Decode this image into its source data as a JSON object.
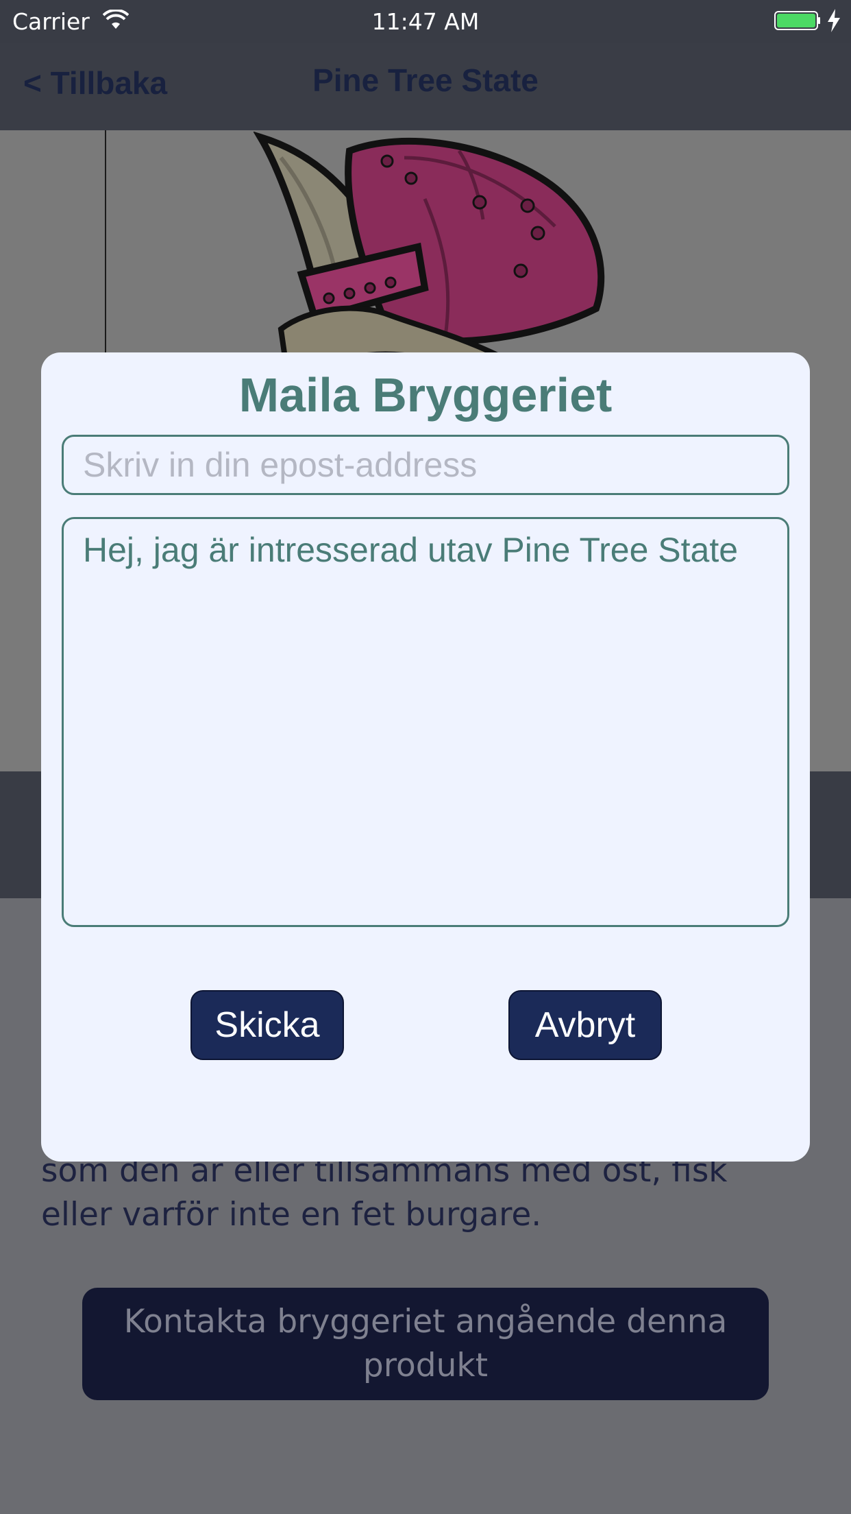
{
  "status_bar": {
    "carrier": "Carrier",
    "time": "11:47 AM",
    "wifi_icon": "wifi-icon",
    "battery_icon": "battery-full-icon",
    "charging_icon": "charging-bolt-icon",
    "battery_color": "#4cd964"
  },
  "nav": {
    "back_label": "< Tillbaka",
    "title": "Pine Tree State"
  },
  "product": {
    "image_icon": "beer-label-art",
    "description": "som den är eller tillsammans med ost, fisk eller varför inte en fet burgare.",
    "contact_button_label": "Kontakta bryggeriet angående denna produkt"
  },
  "modal": {
    "title": "Maila Bryggeriet",
    "email_placeholder": "Skriv in din epost-address",
    "email_value": "",
    "message_value": "Hej, jag är intresserad utav Pine Tree State",
    "send_label": "Skicka",
    "cancel_label": "Avbryt"
  },
  "colors": {
    "accent": "#4a7c77",
    "button": "#1b2a58",
    "modal_bg": "#eff3ff",
    "bar_bg": "#393c45"
  }
}
